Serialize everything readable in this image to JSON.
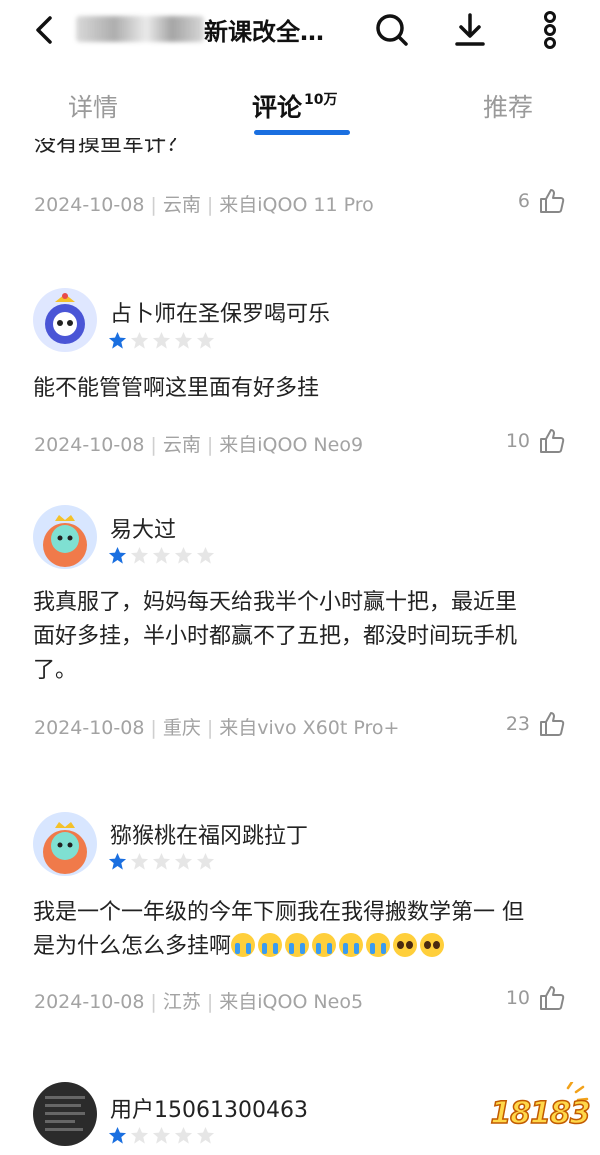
{
  "header": {
    "title": "新课改全…",
    "icons": {
      "back": "chevron-left-icon",
      "search": "search-icon",
      "download": "download-icon",
      "more": "more-vertical-icon"
    }
  },
  "tabs": [
    {
      "label": "详情"
    },
    {
      "label": "评论",
      "count": "10万"
    },
    {
      "label": "推荐"
    }
  ],
  "accent_color": "#1a6fe0",
  "partial_comment": {
    "text": "没有摸鱼军计？",
    "date": "2024-10-08",
    "region": "云南",
    "device": "来自iQOO 11 Pro",
    "likes": "6"
  },
  "comments": [
    {
      "username": "占卜师在圣保罗喝可乐",
      "rating": 1,
      "body_lines": [
        "能不能管管啊这里面有好多挂"
      ],
      "date": "2024-10-08",
      "region": "云南",
      "device": "来自iQOO Neo9",
      "likes": "10"
    },
    {
      "username": "易大过",
      "rating": 1,
      "body_lines": [
        "我真服了，妈妈每天给我半个小时赢十把，最近里",
        "面好多挂，半小时都赢不了五把，都没时间玩手机",
        "了。"
      ],
      "date": "2024-10-08",
      "region": "重庆",
      "device": "来自vivo X60t Pro+",
      "likes": "23"
    },
    {
      "username": "猕猴桃在福冈跳拉丁",
      "rating": 1,
      "body_lines": [
        "我是一个一年级的今年下厕我在我得搬数学第一 但",
        "是为什么怎么多挂啊"
      ],
      "date": "2024-10-08",
      "region": "江苏",
      "device": "来自iQOO Neo5",
      "likes": "10"
    },
    {
      "username": "用户15061300463",
      "rating": 1
    }
  ],
  "watermark": "18183"
}
